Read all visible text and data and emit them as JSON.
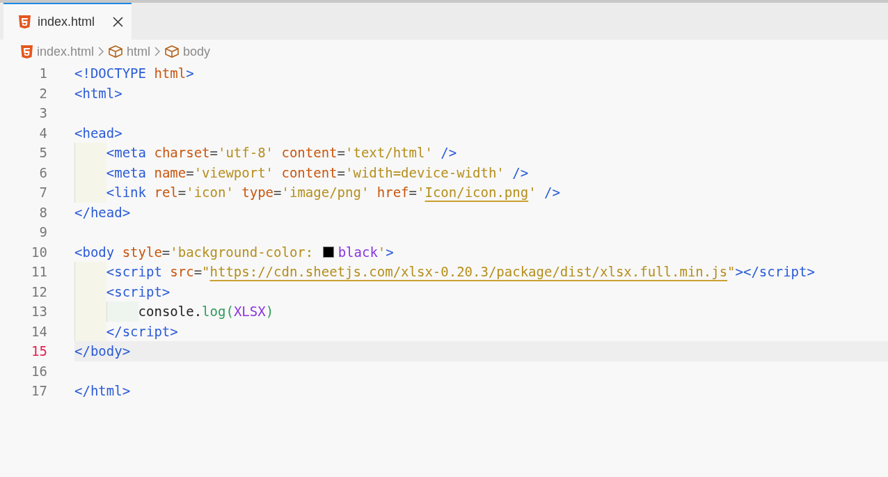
{
  "tabs": [
    {
      "label": "index.html",
      "selected": true
    }
  ],
  "breadcrumb": [
    {
      "label": "index.html",
      "kind": "file"
    },
    {
      "label": "html",
      "kind": "element"
    },
    {
      "label": "body",
      "kind": "element"
    }
  ],
  "lines": [
    {
      "number": "1",
      "current": false,
      "tokens": [
        {
          "kind": "tag",
          "text": "<!DOCTYPE"
        },
        {
          "kind": "attr",
          "text": " html"
        },
        {
          "kind": "tag",
          "text": ">"
        }
      ]
    },
    {
      "number": "2",
      "current": false,
      "tokens": [
        {
          "kind": "tag",
          "text": "<html>"
        }
      ]
    },
    {
      "number": "3",
      "current": false
    },
    {
      "number": "4",
      "current": false,
      "tokens": [
        {
          "kind": "tag",
          "text": "<head>"
        }
      ],
      "children": [
        {
          "number": "5",
          "current": false,
          "tokens": [
            {
              "kind": "tag",
              "text": "<meta"
            },
            {
              "kind": "attr",
              "text": " charset"
            },
            {
              "kind": "punct",
              "text": "="
            },
            {
              "kind": "string",
              "text": "'utf-8'"
            },
            {
              "kind": "attr",
              "text": " content"
            },
            {
              "kind": "punct",
              "text": "="
            },
            {
              "kind": "string",
              "text": "'text/html'"
            },
            {
              "kind": "tag",
              "text": " />"
            }
          ]
        },
        {
          "number": "6",
          "current": false,
          "tokens": [
            {
              "kind": "tag",
              "text": "<meta"
            },
            {
              "kind": "attr",
              "text": " name"
            },
            {
              "kind": "punct",
              "text": "="
            },
            {
              "kind": "string",
              "text": "'viewport'"
            },
            {
              "kind": "attr",
              "text": " content"
            },
            {
              "kind": "punct",
              "text": "="
            },
            {
              "kind": "string",
              "text": "'width=device-width'"
            },
            {
              "kind": "tag",
              "text": " />"
            }
          ]
        },
        {
          "number": "7",
          "current": false,
          "tokens": [
            {
              "kind": "tag",
              "text": "<link"
            },
            {
              "kind": "attr",
              "text": " rel"
            },
            {
              "kind": "punct",
              "text": "="
            },
            {
              "kind": "string",
              "text": "'icon'"
            },
            {
              "kind": "attr",
              "text": " type"
            },
            {
              "kind": "punct",
              "text": "="
            },
            {
              "kind": "string",
              "text": "'image/png'"
            },
            {
              "kind": "attr",
              "text": " href"
            },
            {
              "kind": "punct",
              "text": "="
            },
            {
              "kind": "string",
              "text": "'"
            },
            {
              "kind": "link",
              "text": "Icon/icon.png"
            },
            {
              "kind": "string",
              "text": "'"
            },
            {
              "kind": "tag",
              "text": " />"
            }
          ]
        }
      ]
    },
    {
      "number": "8",
      "current": false,
      "tokens": [
        {
          "kind": "tag",
          "text": "</head>"
        }
      ]
    },
    {
      "number": "9",
      "current": false
    },
    {
      "number": "10",
      "current": false,
      "tokens": [
        {
          "kind": "tag",
          "text": "<body"
        },
        {
          "kind": "attr",
          "text": " style"
        },
        {
          "kind": "punct",
          "text": "="
        },
        {
          "kind": "string",
          "text": "'background-color: "
        },
        {
          "kind": "swatch",
          "color": "#000000"
        },
        {
          "kind": "value",
          "text": "black"
        },
        {
          "kind": "string",
          "text": "'"
        },
        {
          "kind": "tag",
          "text": ">"
        }
      ],
      "children": [
        {
          "number": "11",
          "current": false,
          "tokens": [
            {
              "kind": "tag",
              "text": "<script"
            },
            {
              "kind": "attr",
              "text": " src"
            },
            {
              "kind": "punct",
              "text": "="
            },
            {
              "kind": "string",
              "text": "\""
            },
            {
              "kind": "link",
              "text": "https://cdn.sheetjs.com/xlsx-0.20.3/package/dist/xlsx.full.min.js"
            },
            {
              "kind": "string",
              "text": "\""
            },
            {
              "kind": "tag",
              "text": "></script>"
            }
          ]
        },
        {
          "number": "12",
          "current": false,
          "tokens": [
            {
              "kind": "tag",
              "text": "<script>"
            }
          ],
          "children": [
            {
              "number": "13",
              "current": false,
              "tokens": [
                {
                  "kind": "plain",
                  "text": "console."
                },
                {
                  "kind": "func",
                  "text": "log"
                },
                {
                  "kind": "paren",
                  "text": "("
                },
                {
                  "kind": "value",
                  "text": "XLSX"
                },
                {
                  "kind": "paren",
                  "text": ")"
                }
              ]
            }
          ]
        },
        {
          "number": "14",
          "current": false,
          "tokens": [
            {
              "kind": "tag",
              "text": "</script>"
            }
          ]
        }
      ]
    },
    {
      "number": "15",
      "current": true,
      "tokens": [
        {
          "kind": "tag",
          "text": "</body>"
        }
      ]
    },
    {
      "number": "16",
      "current": false
    },
    {
      "number": "17",
      "current": false,
      "tokens": [
        {
          "kind": "tag",
          "text": "</html>"
        }
      ]
    }
  ]
}
